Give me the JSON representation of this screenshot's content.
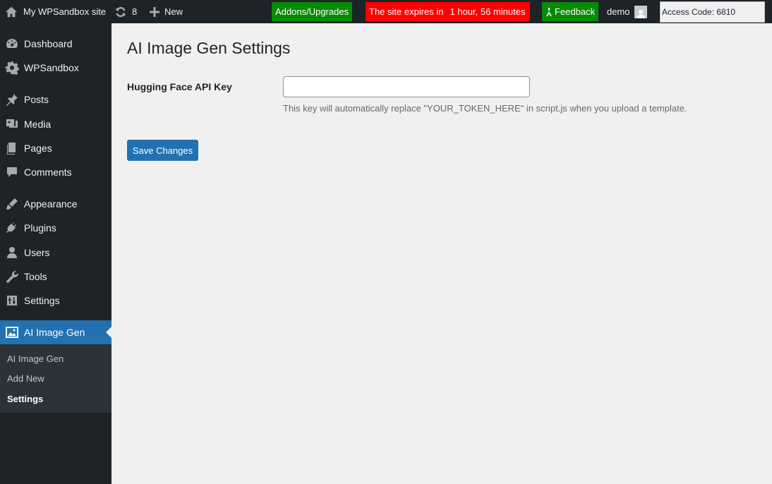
{
  "adminbar": {
    "site_name": "My WPSandbox site",
    "updates_count": "8",
    "new_label": "New",
    "addons_label": "Addons/Upgrades",
    "expires_prefix": "The site expires in",
    "expires_time": "1 hour, 56 minutes",
    "feedback_label": "Feedback",
    "user_name": "demo",
    "access_code": "Access Code: 6810",
    "colors": {
      "bar": "#1d2327",
      "addons": "#058b04",
      "expires": "#ff0000",
      "feedback": "#058b04"
    }
  },
  "sidebar": {
    "items": [
      {
        "label": "Dashboard",
        "icon": "dashboard-icon"
      },
      {
        "label": "WPSandbox",
        "icon": "gear-icon"
      },
      {
        "label": "Posts",
        "icon": "pin-icon"
      },
      {
        "label": "Media",
        "icon": "media-icon"
      },
      {
        "label": "Pages",
        "icon": "pages-icon"
      },
      {
        "label": "Comments",
        "icon": "comment-icon"
      },
      {
        "label": "Appearance",
        "icon": "brush-icon"
      },
      {
        "label": "Plugins",
        "icon": "plugin-icon"
      },
      {
        "label": "Users",
        "icon": "user-icon"
      },
      {
        "label": "Tools",
        "icon": "wrench-icon"
      },
      {
        "label": "Settings",
        "icon": "settings-sliders-icon"
      },
      {
        "label": "AI Image Gen",
        "icon": "image-icon",
        "current": true
      }
    ],
    "submenu": [
      {
        "label": "AI Image Gen"
      },
      {
        "label": "Add New"
      },
      {
        "label": "Settings",
        "active": true
      }
    ],
    "colors": {
      "background": "#1d2327",
      "current": "#2271b1",
      "submenu": "#2c3338"
    }
  },
  "main": {
    "title": "AI Image Gen Settings",
    "api_key_label": "Hugging Face API Key",
    "api_key_value": "",
    "api_key_placeholder": "",
    "description": "This key will automatically replace \"YOUR_TOKEN_HERE\" in script.js when you upload a template.",
    "save_label": "Save Changes"
  }
}
